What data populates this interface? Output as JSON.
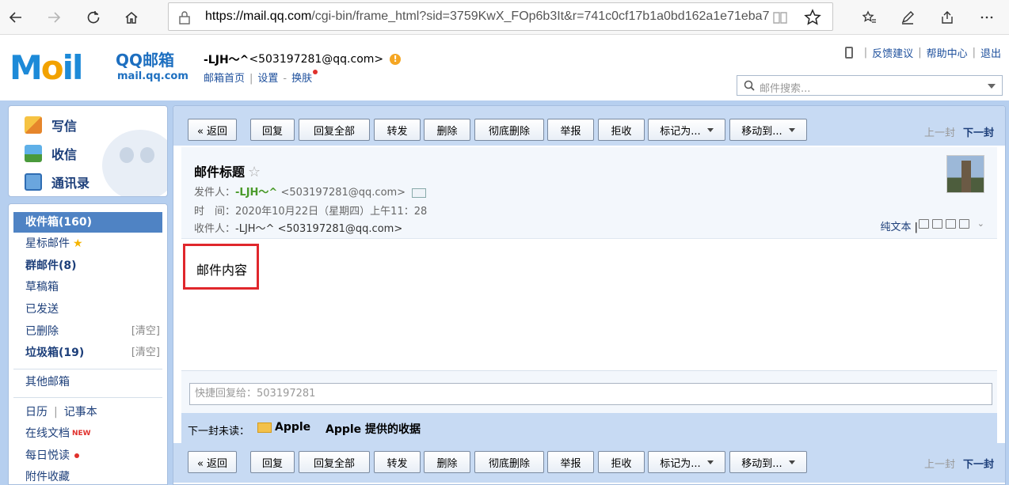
{
  "browser": {
    "url_host": "https://mail.qq.com",
    "url_rest": "/cgi-bin/frame_html?sid=3759KwX_FOp6b3It&r=741c0cf17b1a0bd162a1e71eba7"
  },
  "header": {
    "logo_text": "QQ邮箱",
    "logo_url": "mail.qq.com",
    "user_nick": "-LJH～^",
    "user_email": "<503197281@qq.com>",
    "warn_badge": "!",
    "links": [
      "邮箱首页",
      "设置",
      "换肤"
    ],
    "right_links": [
      "反馈建议",
      "帮助中心",
      "退出"
    ],
    "search_placeholder": "邮件搜索..."
  },
  "quick_actions": {
    "write": "写信",
    "inbox": "收信",
    "contacts": "通讯录"
  },
  "folders": {
    "inbox": "收件箱(160)",
    "starred": "星标邮件",
    "group": "群邮件(8)",
    "drafts": "草稿箱",
    "sent": "已发送",
    "deleted": "已删除",
    "spam": "垃圾箱(19)",
    "clear": "[清空]",
    "other": "其他邮箱",
    "calendar": "日历",
    "notes": "记事本",
    "docs": "在线文档",
    "new_tag": "NEW",
    "daily": "每日悦读",
    "attach": "附件收藏"
  },
  "toolbar": {
    "back": "« 返回",
    "reply": "回复",
    "reply_all": "回复全部",
    "forward": "转发",
    "delete": "删除",
    "delete_perm": "彻底删除",
    "report": "举报",
    "reject": "拒收",
    "mark_as": "标记为...",
    "move_to": "移动到...",
    "prev": "上一封",
    "next": "下一封"
  },
  "mail": {
    "subject": "邮件标题",
    "from_label": "发件人：",
    "from_nick": "-LJH～^",
    "from_email": "<503197281@qq.com>",
    "time_label": "时　间：",
    "time_value": "2020年10月22日（星期四）上午11：28",
    "to_label": "收件人：",
    "to_value": "-LJH～^ <503197281@qq.com>",
    "plain_text": "纯文本",
    "body": "邮件内容"
  },
  "quick_reply": {
    "placeholder": "快捷回复给：503197281"
  },
  "next_unread": {
    "label": "下一封未读：",
    "from": "Apple",
    "subject": "Apple 提供的收据"
  }
}
